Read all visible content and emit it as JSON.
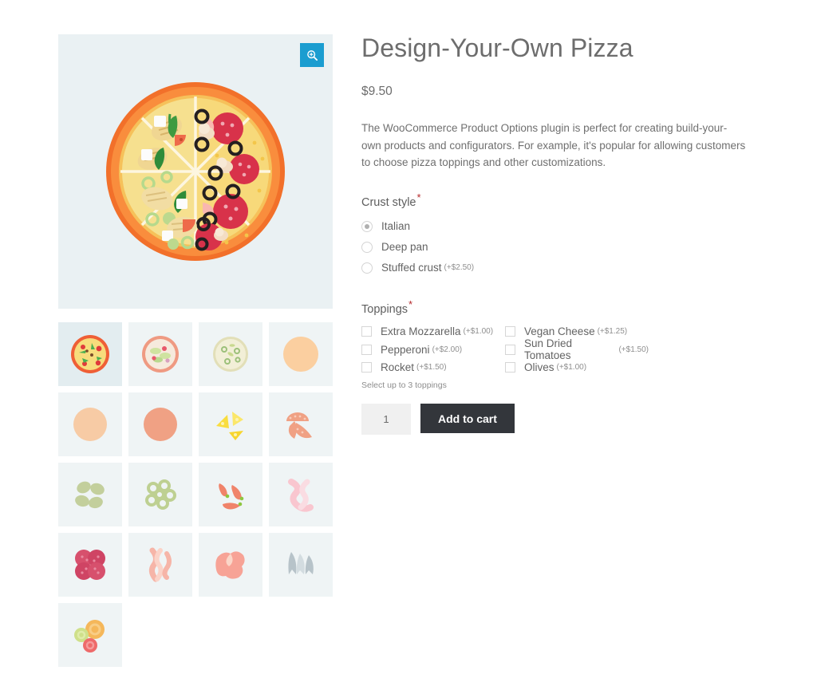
{
  "gallery": {
    "zoom_button_label": "Zoom",
    "zoom_icon": "magnifier-plus-icon",
    "main_image_alt": "Sliced pizza illustration with assorted toppings",
    "thumbnails": [
      {
        "name": "pizza-vegetable",
        "alt": "Whole pizza with vegetables",
        "active": true
      },
      {
        "name": "pizza-salad",
        "alt": "Pizza topped with salad"
      },
      {
        "name": "pizza-white",
        "alt": "White pizza with herbs"
      },
      {
        "name": "dough-base-peach",
        "alt": "Pizza dough base"
      },
      {
        "name": "dough-base-light",
        "alt": "Pale pizza dough base"
      },
      {
        "name": "tomato-base",
        "alt": "Tomato sauce base"
      },
      {
        "name": "cheese-wedges",
        "alt": "Cheese wedges"
      },
      {
        "name": "mushrooms",
        "alt": "Sliced mushrooms"
      },
      {
        "name": "olives-whole",
        "alt": "Green olives"
      },
      {
        "name": "olive-rings",
        "alt": "Sliced olive rings"
      },
      {
        "name": "chili-peppers",
        "alt": "Chili peppers"
      },
      {
        "name": "ham-ribbons",
        "alt": "Ham ribbons"
      },
      {
        "name": "salami-slices",
        "alt": "Salami slices"
      },
      {
        "name": "bacon-strips",
        "alt": "Bacon strips"
      },
      {
        "name": "ham-slices",
        "alt": "Ham slices"
      },
      {
        "name": "anchovies",
        "alt": "Anchovies"
      },
      {
        "name": "pepper-rings",
        "alt": "Coloured pepper rings"
      }
    ]
  },
  "product": {
    "title": "Design-Your-Own Pizza",
    "price": "$9.50",
    "description": "The WooCommerce Product Options plugin is perfect for creating build-your-own products and configurators. For example, it's popular for allowing customers to choose pizza toppings and other customizations.",
    "required_marker": "*"
  },
  "crust": {
    "label": "Crust style",
    "options": [
      {
        "label": "Italian",
        "price": "",
        "selected": true
      },
      {
        "label": "Deep pan",
        "price": "",
        "selected": false
      },
      {
        "label": "Stuffed crust",
        "price": "(+$2.50)",
        "selected": false
      }
    ]
  },
  "toppings": {
    "label": "Toppings",
    "helper": "Select up to 3 toppings",
    "column_left": [
      {
        "label": "Extra Mozzarella",
        "price": "(+$1.00)",
        "checked": false
      },
      {
        "label": "Pepperoni",
        "price": "(+$2.00)",
        "checked": false
      },
      {
        "label": "Rocket",
        "price": "(+$1.50)",
        "checked": false
      }
    ],
    "column_right": [
      {
        "label": "Vegan Cheese",
        "price": "(+$1.25)",
        "checked": false
      },
      {
        "label": "Sun Dried Tomatoes",
        "price": "(+$1.50)",
        "checked": false
      },
      {
        "label": "Olives",
        "price": "(+$1.00)",
        "checked": false
      }
    ]
  },
  "cart": {
    "quantity": "1",
    "add_to_cart_label": "Add to cart"
  },
  "colors": {
    "zoom_button": "#1b9dd0",
    "add_to_cart": "#33363b",
    "required": "#b5292b",
    "gallery_bg": "#eaf1f3",
    "thumb_bg": "#eff4f5"
  }
}
